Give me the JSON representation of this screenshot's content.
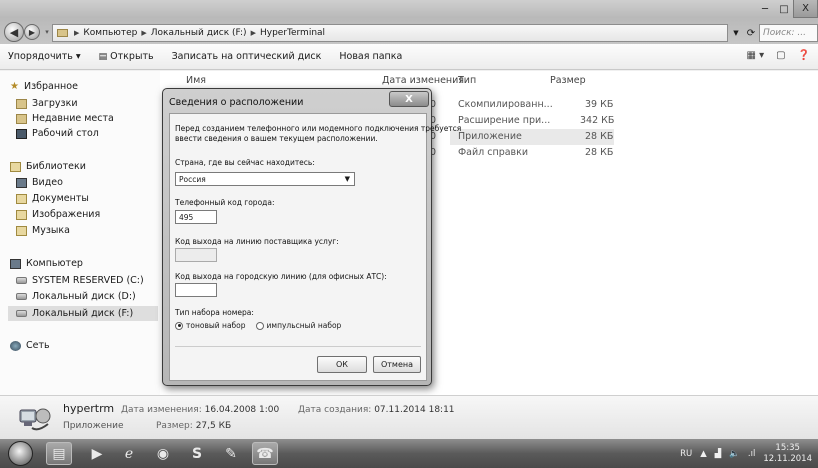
{
  "window": {
    "breadcrumb": [
      "Компьютер",
      "Локальный диск (F:)",
      "HyperTerminal"
    ],
    "search_placeholder": "Поиск: ...",
    "minimize": "─",
    "maximize": "□",
    "close": "X"
  },
  "toolbar": {
    "organize": "Упорядочить ▾",
    "open": "Открыть",
    "burn": "Записать на оптический диск",
    "new_folder": "Новая папка"
  },
  "sidebar": {
    "favorites": "Избранное",
    "downloads": "Загрузки",
    "recent": "Недавние места",
    "desktop": "Рабочий стол",
    "libraries": "Библиотеки",
    "video": "Видео",
    "documents": "Документы",
    "images": "Изображения",
    "music": "Музыка",
    "computer": "Компьютер",
    "drive_c": "SYSTEM RESERVED (C:)",
    "drive_d": "Локальный диск (D:)",
    "drive_f": "Локальный диск (F:)",
    "network": "Сеть"
  },
  "filelist": {
    "columns": [
      "Имя",
      "Дата изменения",
      "Тип",
      "Размер"
    ],
    "rows": [
      {
        "date_fragment": "0",
        "type": "Скомпилированн...",
        "size": "39 КБ"
      },
      {
        "date_fragment": "0",
        "type": "Расширение при...",
        "size": "342 КБ"
      },
      {
        "date_fragment": "0",
        "type": "Приложение",
        "size": "28 КБ"
      },
      {
        "date_fragment": "0",
        "type": "Файл справки",
        "size": "28 КБ"
      }
    ]
  },
  "dialog": {
    "title": "Сведения о расположении",
    "close": "X",
    "intro_line1": "Перед созданием телефонного или модемного подключения требуется",
    "intro_line2": "ввести сведения о вашем текущем расположении.",
    "country_label": "Страна, где вы сейчас находитесь:",
    "country_value": "Россия",
    "area_code_label": "Телефонный код города:",
    "area_code_value": "495",
    "carrier_label": "Код выхода на линию поставщика услуг:",
    "carrier_value": "",
    "outside_label": "Код выхода на городскую линию (для офисных АТС):",
    "outside_value": "",
    "dial_type_label": "Тип набора номера:",
    "tone": "тоновый набор",
    "pulse": "импульсный набор",
    "ok": "ОК",
    "cancel": "Отмена"
  },
  "details": {
    "name": "hypertrm",
    "type": "Приложение",
    "modified_label": "Дата изменения:",
    "modified_value": "16.04.2008 1:00",
    "created_label": "Дата создания:",
    "created_value": "07.11.2014 18:11",
    "size_label": "Размер:",
    "size_value": "27,5 КБ"
  },
  "taskbar": {
    "lang": "RU",
    "time": "15:35",
    "date": "12.11.2014"
  }
}
